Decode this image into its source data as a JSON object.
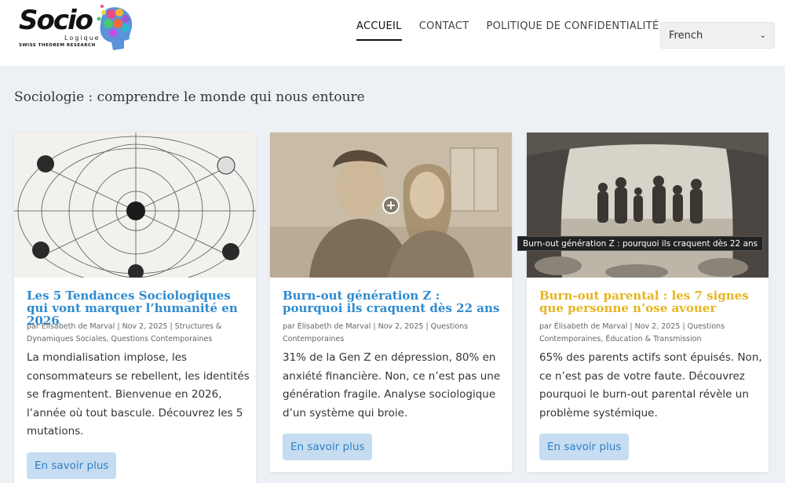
{
  "header": {
    "logo": {
      "word": "Socio",
      "sub": "Logique",
      "tagline": "SWISS THEOREM RESEARCH"
    },
    "nav": [
      {
        "label": "ACCUEIL",
        "active": true
      },
      {
        "label": "CONTACT",
        "active": false
      },
      {
        "label": "POLITIQUE DE CONFIDENTIALITÉ",
        "active": false
      }
    ],
    "language": {
      "selected": "French",
      "icon": "chevron-down-icon"
    }
  },
  "page": {
    "title": "Sociologie : comprendre le monde qui nous entoure"
  },
  "cards": [
    {
      "title": "Les 5 Tendances Sociologiques qui vont marquer l’humanité en 2026",
      "meta": "par Élisabeth de Marval | Nov 2, 2025 | Structures & Dynamiques Sociales, Questions Contemporaines",
      "excerpt": "La mondialisation implose, les consommateurs se rebellent, les identités se fragmentent. Bienvenue en 2026, l’année où tout bascule. Découvrez les 5 mutations.",
      "button": "En savoir plus",
      "title_color": "#2e8bd0"
    },
    {
      "title": "Burn-out génération Z : pourquoi ils craquent dès 22 ans",
      "meta": "par Élisabeth de Marval | Nov 2, 2025 | Questions Contemporaines",
      "excerpt": "31% de la Gen Z en dépression, 80% en anxiété financière. Non, ce n’est pas une génération fragile. Analyse sociologique d’un système qui broie.",
      "button": "En savoir plus",
      "title_color": "#2e8bd0"
    },
    {
      "title": "Burn-out parental : les 7 signes que personne n’ose avouer",
      "meta": "par Élisabeth de Marval | Nov 2, 2025 | Questions Contemporaines, Éducation & Transmission",
      "excerpt": "65% des parents actifs sont épuisés. Non, ce n’est pas de votre faute. Découvrez pourquoi le burn-out parental révèle un problème systémique.",
      "button": "En savoir plus",
      "title_color": "#e6b521"
    }
  ],
  "tooltip": {
    "text": "Burn-out génération Z : pourquoi ils craquent dès 22 ans"
  },
  "colors": {
    "link_blue": "#2e8bd0",
    "accent_yellow": "#e6b521",
    "button_bg": "#c6dcf0",
    "page_bg": "#edf0f4"
  }
}
